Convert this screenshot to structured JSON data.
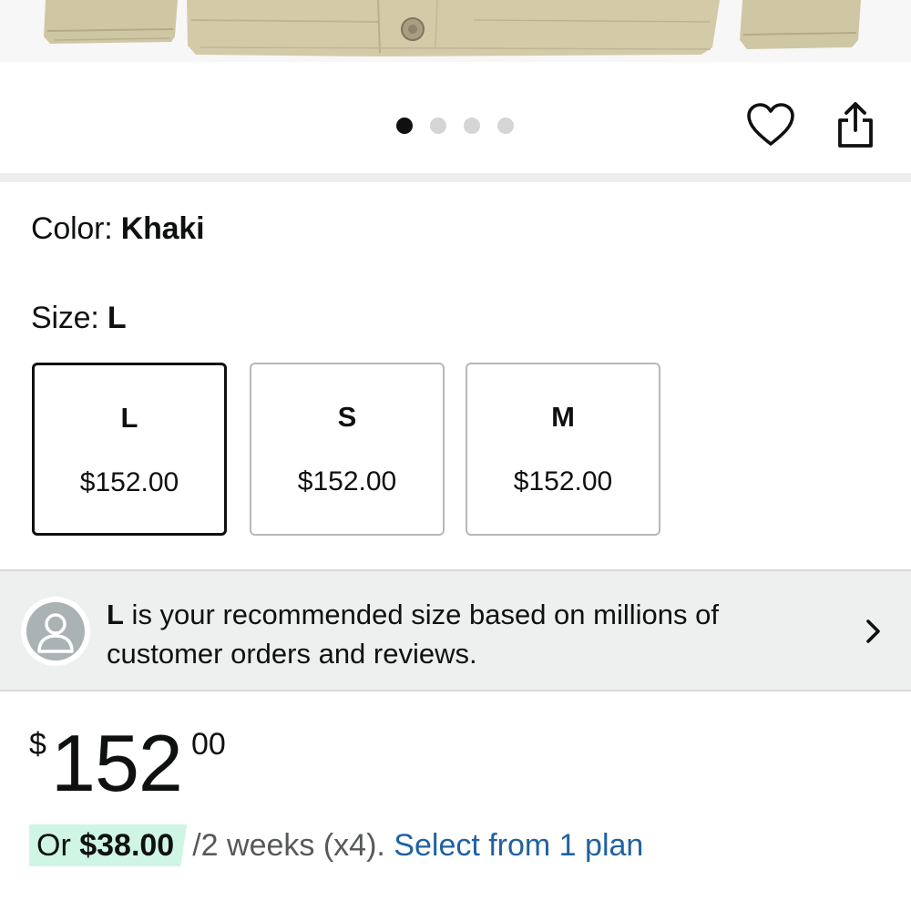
{
  "carousel": {
    "slide_count": 4,
    "active_index": 0
  },
  "variation": {
    "color_prefix": "Color: ",
    "color_value": "Khaki",
    "size_prefix": "Size: ",
    "size_value": "L"
  },
  "sizes": [
    {
      "label": "L",
      "price": "$152.00",
      "selected": true
    },
    {
      "label": "S",
      "price": "$152.00",
      "selected": false
    },
    {
      "label": "M",
      "price": "$152.00",
      "selected": false
    }
  ],
  "recommendation": {
    "size": "L",
    "text": " is your recommended size based on millions of customer orders and reviews."
  },
  "price": {
    "symbol": "$",
    "whole": "152",
    "fraction": "00"
  },
  "installment": {
    "prefix": "Or ",
    "amount": "$38.00",
    "terms": "/2 weeks (x4).",
    "link": "Select from 1 plan"
  },
  "icons": {
    "wishlist": "heart-icon",
    "share": "share-icon",
    "avatar": "user-avatar-icon",
    "chevron": "chevron-right-icon"
  },
  "colors": {
    "text": "#0f1111",
    "link": "#2162a1",
    "highlight": "#cff5e5",
    "banner_bg": "#eef0ef",
    "dot_inactive": "#d5d5d5",
    "product_khaki": "#cfc7a4"
  }
}
